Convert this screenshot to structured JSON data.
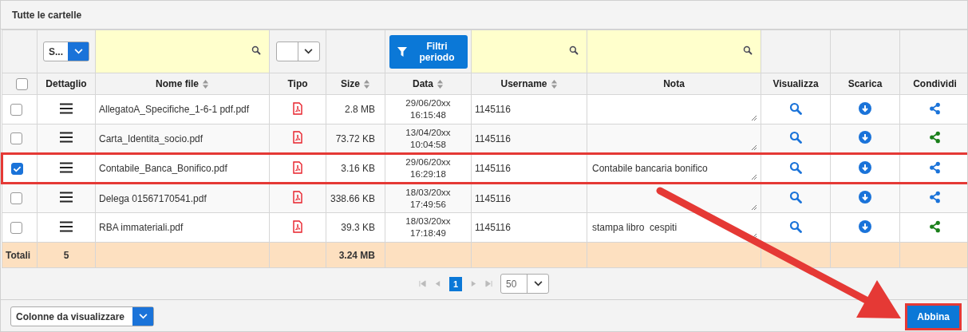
{
  "panel": {
    "title": "Tutte le cartelle"
  },
  "filters": {
    "detail_select": "S...",
    "period_button": "Filtri periodo"
  },
  "select_all_checked": false,
  "columns": [
    {
      "label": "Dettaglio",
      "sortable": false
    },
    {
      "label": "Nome file",
      "sortable": true
    },
    {
      "label": "Tipo",
      "sortable": false
    },
    {
      "label": "Size",
      "sortable": true
    },
    {
      "label": "Data",
      "sortable": true
    },
    {
      "label": "Username",
      "sortable": true
    },
    {
      "label": "Nota",
      "sortable": false
    },
    {
      "label": "Visualizza",
      "sortable": false
    },
    {
      "label": "Scarica",
      "sortable": false
    },
    {
      "label": "Condividi",
      "sortable": false
    }
  ],
  "rows": [
    {
      "checked": false,
      "highlighted": false,
      "file_name": "AllegatoA_Specifiche_1-6-1 pdf.pdf",
      "size": "2.8 MB",
      "date": "29/06/20xx",
      "time": "16:15:48",
      "username": "1145116",
      "shared": false
    },
    {
      "checked": false,
      "highlighted": false,
      "file_name": "Carta_Identita_socio.pdf",
      "size": "73.72 KB",
      "date": "13/04/20xx",
      "time": "10:04:58",
      "username": "1145116",
      "shared": true
    },
    {
      "checked": true,
      "highlighted": true,
      "file_name": "Contabile_Banca_Bonifico.pdf",
      "size": "3.16 KB",
      "date": "29/06/20xx",
      "time": "16:29:18",
      "username": "1145116",
      "note": "Contabile bancaria bonifico",
      "shared": false
    },
    {
      "checked": false,
      "highlighted": false,
      "file_name": "Delega 01567170541.pdf",
      "size": "338.66 KB",
      "date": "18/03/20xx",
      "time": "17:49:56",
      "username": "1145116",
      "shared": false
    },
    {
      "checked": false,
      "highlighted": false,
      "file_name": "RBA immateriali.pdf",
      "size": "39.3 KB",
      "date": "18/03/20xx",
      "time": "17:18:49",
      "username": "1145116",
      "note": "stampa libro  cespiti",
      "shared": true
    }
  ],
  "totals": {
    "label": "Totali",
    "count": "5",
    "size": "3.24 MB"
  },
  "pager": {
    "pages": [
      {
        "label": "1",
        "selected": true
      }
    ],
    "page_size": "50"
  },
  "columns_button": "Colonne da visualizzare",
  "action_button": {
    "label": "Abbina",
    "highlighted": true
  }
}
